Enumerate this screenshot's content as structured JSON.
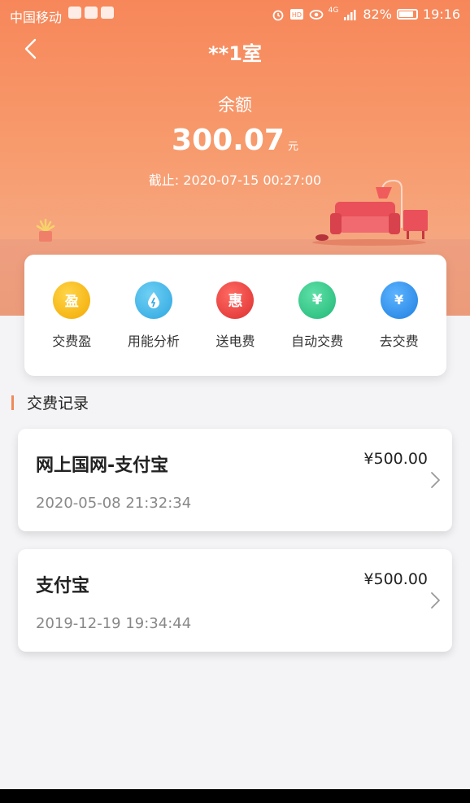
{
  "status_bar": {
    "carrier": "中国移动",
    "network": "4G",
    "battery": "82%",
    "time": "19:16"
  },
  "header": {
    "title": "**1室",
    "back_icon": "chevron-left-icon"
  },
  "balance": {
    "label": "余额",
    "amount": "300.07",
    "unit": "元",
    "as_of": "截止: 2020-07-15 00:27:00"
  },
  "actions": [
    {
      "label": "交费盈",
      "glyph": "盈",
      "color": "#f5b400"
    },
    {
      "label": "用能分析",
      "glyph": "💧",
      "color": "#3db4e8"
    },
    {
      "label": "送电费",
      "glyph": "惠",
      "color": "#e8433d"
    },
    {
      "label": "自动交费",
      "glyph": "¥",
      "color": "#2ec98b"
    },
    {
      "label": "去交费",
      "glyph": "¥",
      "color": "#2f8fe6"
    }
  ],
  "section": {
    "title": "交费记录"
  },
  "records": [
    {
      "name": "网上国网-支付宝",
      "amount": "¥500.00",
      "date": "2020-05-08 21:32:34"
    },
    {
      "name": "支付宝",
      "amount": "¥500.00",
      "date": "2019-12-19 19:34:44"
    }
  ],
  "colors": {
    "accent": "#f08a5b",
    "header_top": "#f7875a"
  }
}
